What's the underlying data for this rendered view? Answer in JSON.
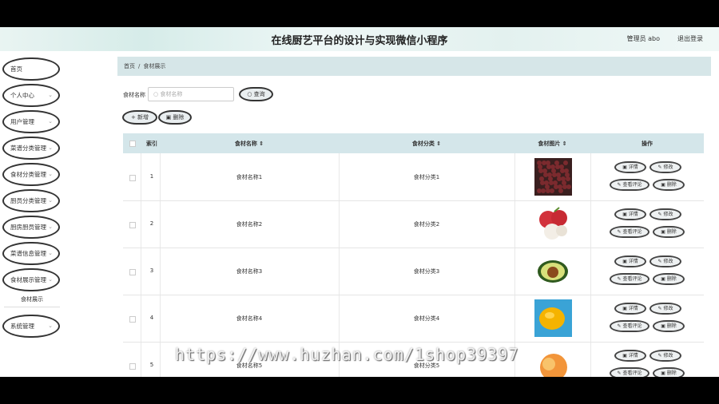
{
  "header": {
    "title": "在线厨艺平台的设计与实现微信小程序",
    "user": "管理员 abo",
    "logout": "退出登录"
  },
  "sidebar": {
    "items": [
      {
        "label": "首页",
        "chev": ""
      },
      {
        "label": "个人中心",
        "chev": "⌄"
      },
      {
        "label": "用户管理",
        "chev": "⌄"
      },
      {
        "label": "菜谱分类管理",
        "chev": "⌄"
      },
      {
        "label": "食材分类管理",
        "chev": "⌄"
      },
      {
        "label": "厨员分类管理",
        "chev": "⌄"
      },
      {
        "label": "厨房厨员管理",
        "chev": "⌄"
      },
      {
        "label": "菜谱信息管理",
        "chev": "⌄"
      },
      {
        "label": "食材展示管理",
        "chev": "⌄"
      },
      {
        "label": "系统管理",
        "chev": "⌄"
      }
    ],
    "subitem": "食材展示"
  },
  "breadcrumb": {
    "home": "首页",
    "sep": "/",
    "current": "食材展示"
  },
  "search": {
    "label": "食材名称",
    "placeholder": "食材名称",
    "button": "查询"
  },
  "actions": {
    "add": "+ 新增",
    "delete": "删除"
  },
  "table": {
    "headers": {
      "index": "索引",
      "name": "食材名称 ⇕",
      "category": "食材分类 ⇕",
      "image": "食材图片 ⇕",
      "ops": "操作"
    },
    "rows": [
      {
        "index": "1",
        "name": "食材名称1",
        "category": "食材分类1",
        "image": "blackberry"
      },
      {
        "index": "2",
        "name": "食材名称2",
        "category": "食材分类2",
        "image": "lychee"
      },
      {
        "index": "3",
        "name": "食材名称3",
        "category": "食材分类3",
        "image": "avocado"
      },
      {
        "index": "4",
        "name": "食材名称4",
        "category": "食材分类4",
        "image": "lemon"
      },
      {
        "index": "5",
        "name": "食材名称5",
        "category": "食材分类5",
        "image": "peach"
      }
    ],
    "ops": {
      "detail": "▣ 详情",
      "edit": "✎ 修改",
      "review": "✎ 查看评论",
      "remove": "▣ 删除"
    }
  },
  "watermark": "https://www.huzhan.com/1shop39397",
  "colors": {
    "accent": "#d4e6ea",
    "header_bg": "#e3f1ef"
  }
}
